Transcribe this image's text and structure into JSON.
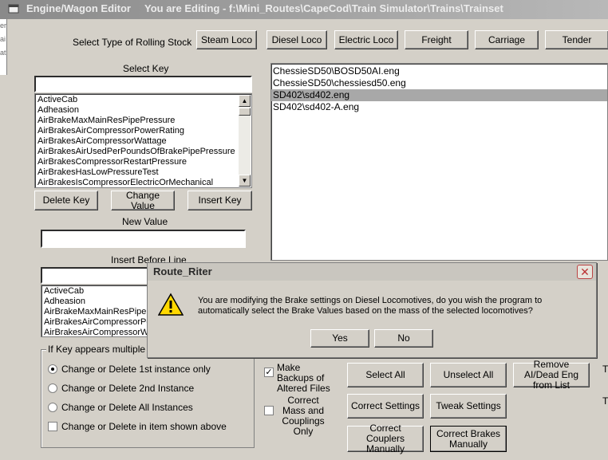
{
  "window": {
    "title": "Engine/Wagon Editor",
    "editing_label": "You are Editing - f:\\Mini_Routes\\CapeCod\\Train Simulator\\Trains\\Trainset",
    "left_strip": [
      "er",
      "ai",
      "at"
    ]
  },
  "rolling_stock": {
    "label": "Select Type of Rolling Stock",
    "buttons": [
      "Steam Loco",
      "Diesel Loco",
      "Electric Loco",
      "Freight",
      "Carriage",
      "Tender"
    ]
  },
  "select_key": {
    "label": "Select Key",
    "search_value": "",
    "items": [
      "ActiveCab",
      "Adheasion",
      "AirBrakeMaxMainResPipePressure",
      "AirBrakesAirCompressorPowerRating",
      "AirBrakesAirCompressorWattage",
      "AirBrakesAirUsedPerPoundsOfBrakePipePressure",
      "AirBrakesCompressorRestartPressure",
      "AirBrakesHasLowPressureTest",
      "AirBrakesIsCompressorElectricOrMechanical"
    ]
  },
  "key_buttons": [
    "Delete Key",
    "Change Value",
    "Insert Key"
  ],
  "new_value": {
    "label": "New Value",
    "value": ""
  },
  "insert_before": {
    "label": "Insert Before Line",
    "value": "",
    "items": [
      "ActiveCab",
      "Adheasion",
      "AirBrakeMaxMainResPipeF",
      "AirBrakesAirCompressorPow",
      "AirBrakesAirCompressorWa"
    ]
  },
  "files": {
    "items": [
      "ChessieSD50\\BOSD50AI.eng",
      "ChessieSD50\\chessiesd50.eng",
      "SD402\\sd402.eng",
      "SD402\\sd402-A.eng"
    ],
    "selected_index": 2
  },
  "multiple_times": {
    "label": "If Key appears multiple times",
    "options": [
      "Change or Delete 1st instance only",
      "Change or Delete 2nd Instance",
      "Change or Delete All Instances"
    ],
    "checkbox": "Change or Delete in item shown above"
  },
  "options": {
    "make_backups": "Make Backups of Altered Files",
    "correct_mass": "Correct Mass and Couplings Only"
  },
  "action_buttons": {
    "select_all": "Select All",
    "unselect_all": "Unselect All",
    "remove_ai": "Remove AI/Dead Eng from List",
    "correct_settings": "Correct Settings",
    "tweak_settings": "Tweak Settings",
    "correct_couplers": "Correct Couplers Manually",
    "correct_brakes": "Correct Brakes Manually"
  },
  "right_edge": [
    "T",
    "T"
  ],
  "dialog": {
    "title": "Route_Riter",
    "message": "You are modifying the Brake settings on Diesel Locomotives, do you wish the program to automatically select the Brake Values based on the mass of the selected locomotives?",
    "yes": "Yes",
    "no": "No"
  }
}
